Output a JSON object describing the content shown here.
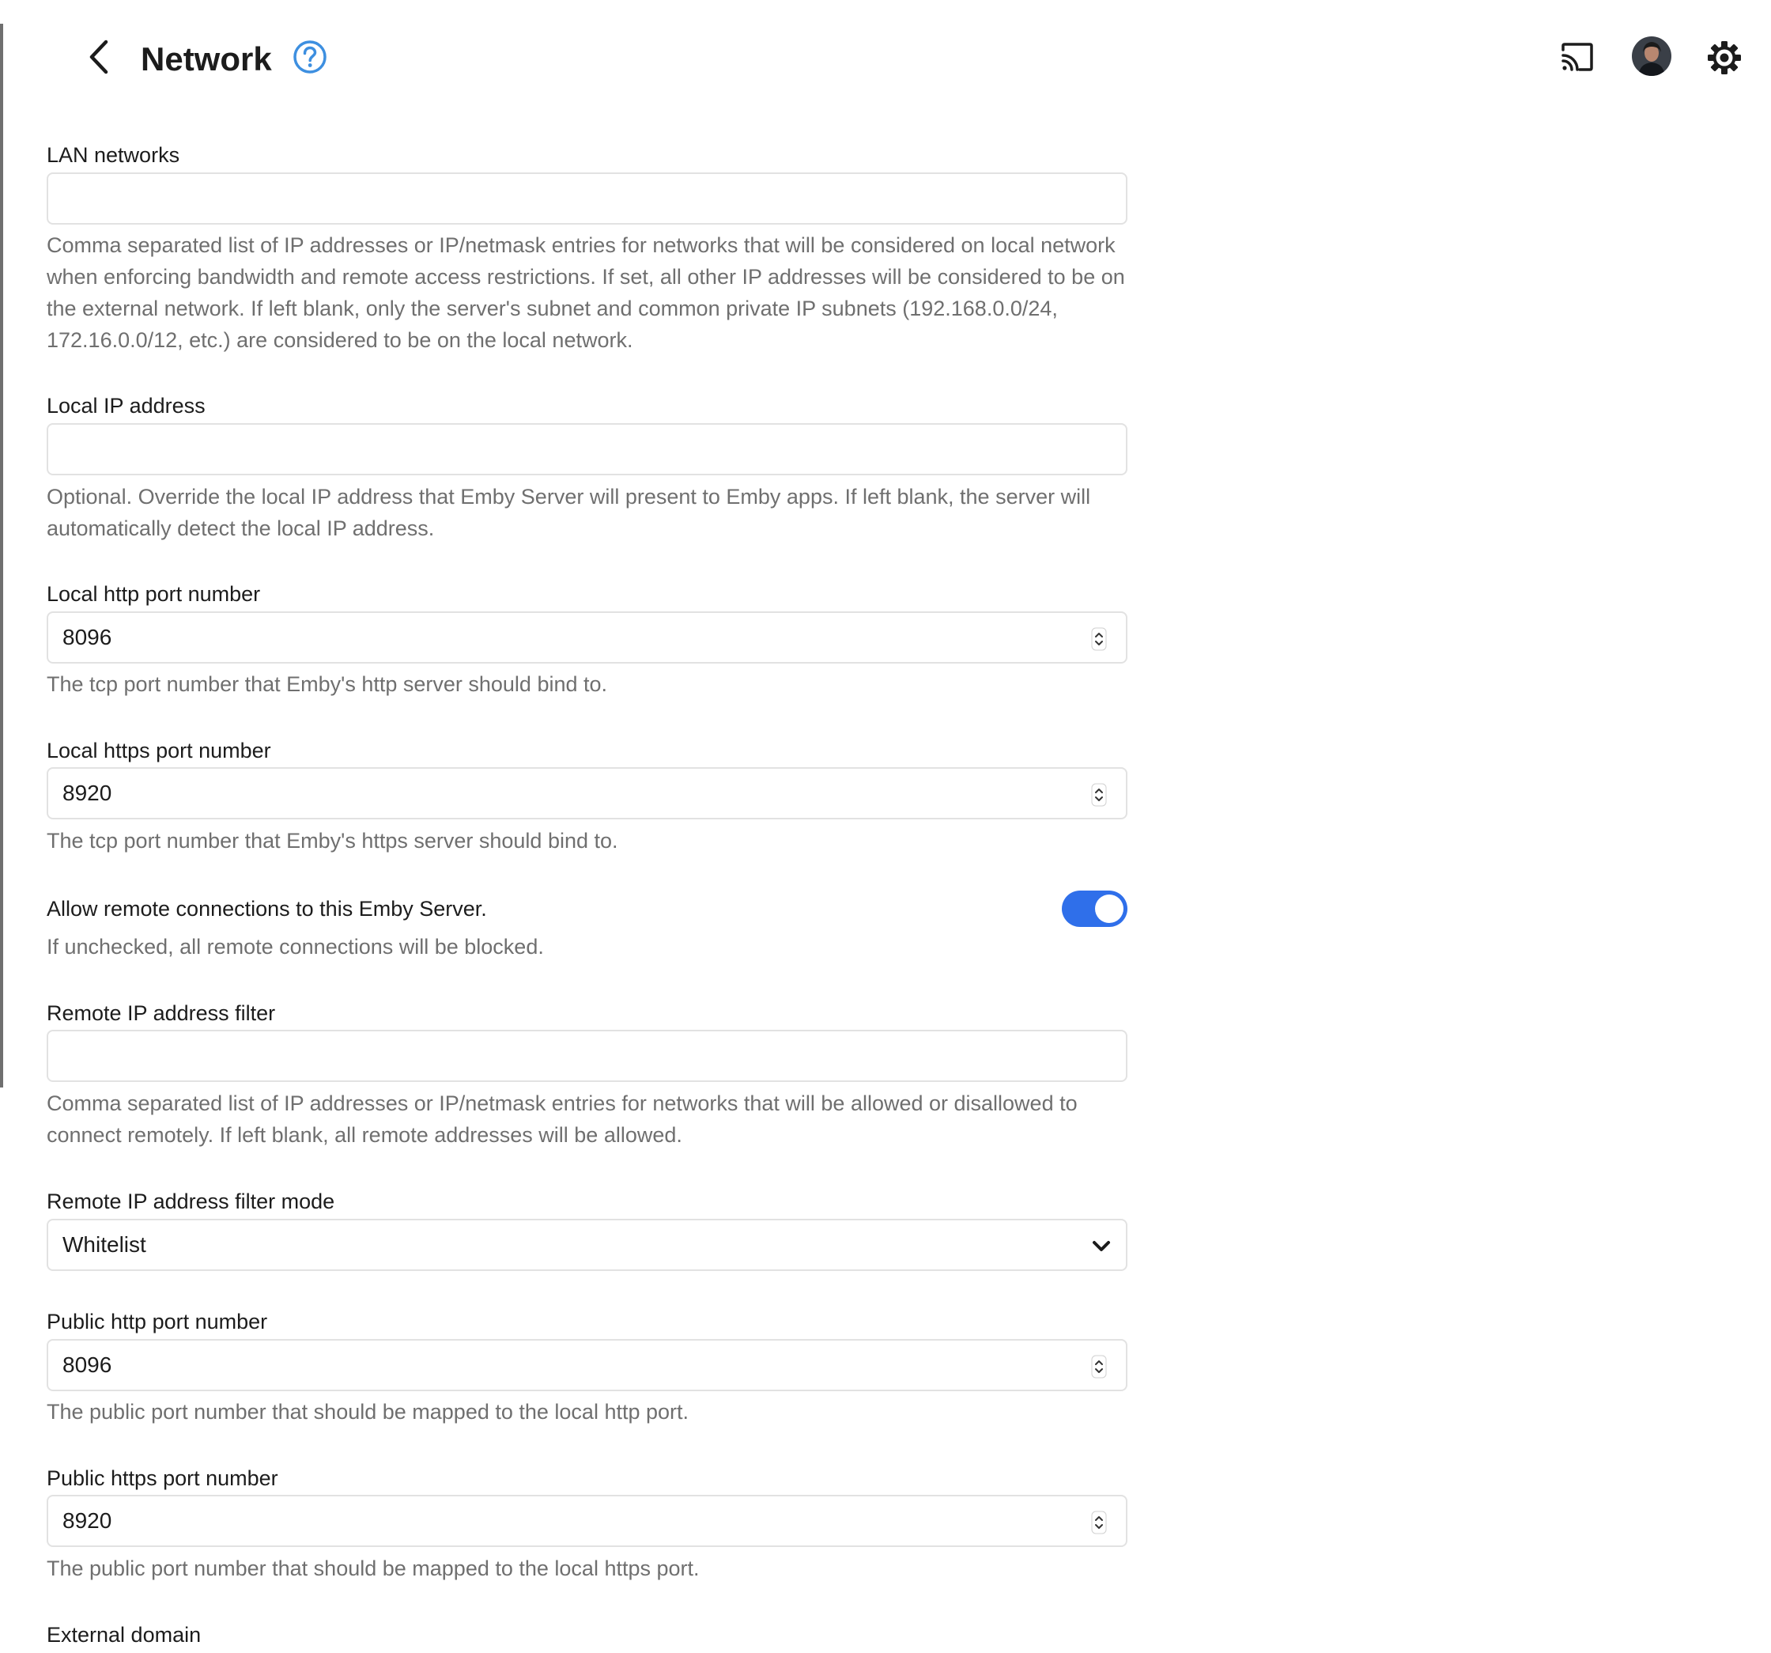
{
  "header": {
    "title": "Network",
    "back_icon": "chevron-left-icon",
    "help_icon": "help-circle-icon",
    "cast_icon": "cast-icon",
    "avatar_icon": "user-avatar",
    "settings_icon": "gear-icon",
    "accent_color": "#3d8fe0"
  },
  "fields": {
    "lan_networks": {
      "label": "LAN networks",
      "value": "",
      "help": "Comma separated list of IP addresses or IP/netmask entries for networks that will be considered on local network when enforcing bandwidth and remote access restrictions. If set, all other IP addresses will be considered to be on the external network. If left blank, only the server's subnet and common private IP subnets (192.168.0.0/24, 172.16.0.0/12, etc.) are considered to be on the local network."
    },
    "local_ip": {
      "label": "Local IP address",
      "value": "",
      "help": "Optional. Override the local IP address that Emby Server will present to Emby apps. If left blank, the server will automatically detect the local IP address."
    },
    "local_http_port": {
      "label": "Local http port number",
      "value": "8096",
      "help": "The tcp port number that Emby's http server should bind to."
    },
    "local_https_port": {
      "label": "Local https port number",
      "value": "8920",
      "help": "The tcp port number that Emby's https server should bind to."
    },
    "allow_remote": {
      "label": "Allow remote connections to this Emby Server.",
      "checked": true,
      "help": "If unchecked, all remote connections will be blocked.",
      "toggle_color": "#2f6fea"
    },
    "remote_ip_filter": {
      "label": "Remote IP address filter",
      "value": "",
      "help": "Comma separated list of IP addresses or IP/netmask entries for networks that will be allowed or disallowed to connect remotely. If left blank, all remote addresses will be allowed."
    },
    "remote_ip_filter_mode": {
      "label": "Remote IP address filter mode",
      "selected": "Whitelist"
    },
    "public_http_port": {
      "label": "Public http port number",
      "value": "8096",
      "help": "The public port number that should be mapped to the local http port."
    },
    "public_https_port": {
      "label": "Public https port number",
      "value": "8920",
      "help": "The public port number that should be mapped to the local https port."
    },
    "external_domain": {
      "label": "External domain"
    }
  }
}
